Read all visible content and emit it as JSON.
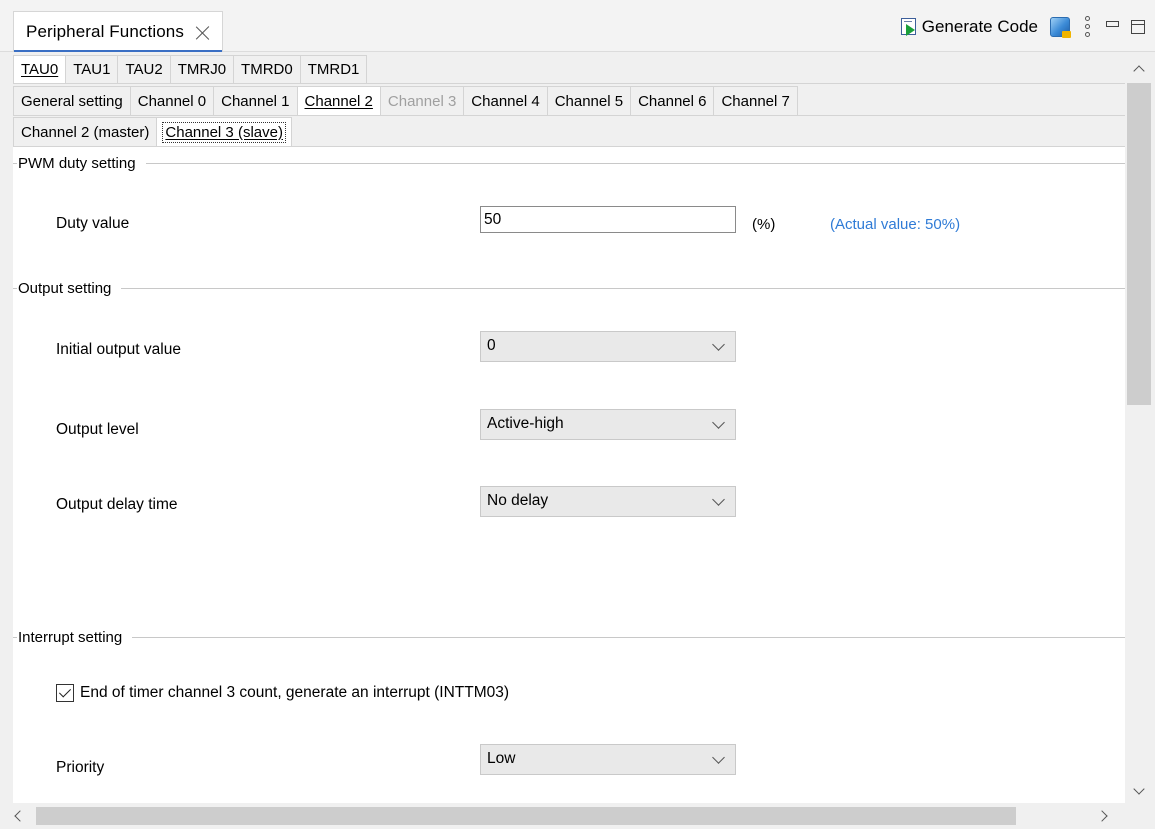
{
  "view": {
    "title": "Peripheral Functions",
    "generate_code_label": "Generate Code"
  },
  "tabs_level1": [
    "TAU0",
    "TAU1",
    "TAU2",
    "TMRJ0",
    "TMRD0",
    "TMRD1"
  ],
  "tabs_level2": [
    "General setting",
    "Channel 0",
    "Channel 1",
    "Channel 2",
    "Channel 3",
    "Channel 4",
    "Channel 5",
    "Channel 6",
    "Channel 7"
  ],
  "tabs_level3": [
    "Channel 2 (master)",
    "Channel 3 (slave)"
  ],
  "pwm_duty": {
    "group_title": "PWM duty setting",
    "duty_label": "Duty value",
    "duty_value": "50",
    "unit": "(%)",
    "actual_value": "(Actual value: 50%)"
  },
  "output": {
    "group_title": "Output setting",
    "initial_output_label": "Initial output value",
    "initial_output_value": "0",
    "output_level_label": "Output level",
    "output_level_value": "Active-high",
    "output_delay_label": "Output delay time",
    "output_delay_value": "No delay"
  },
  "interrupt": {
    "group_title": "Interrupt setting",
    "checkbox_label": "End of timer channel 3 count, generate an interrupt (INTTM03)",
    "checkbox_checked": true,
    "priority_label": "Priority",
    "priority_value": "Low"
  },
  "colors": {
    "accent": "#3a6fc4",
    "actual_value_text": "#2f7bd6",
    "disabled_tab_text": "#a0a0a0"
  }
}
